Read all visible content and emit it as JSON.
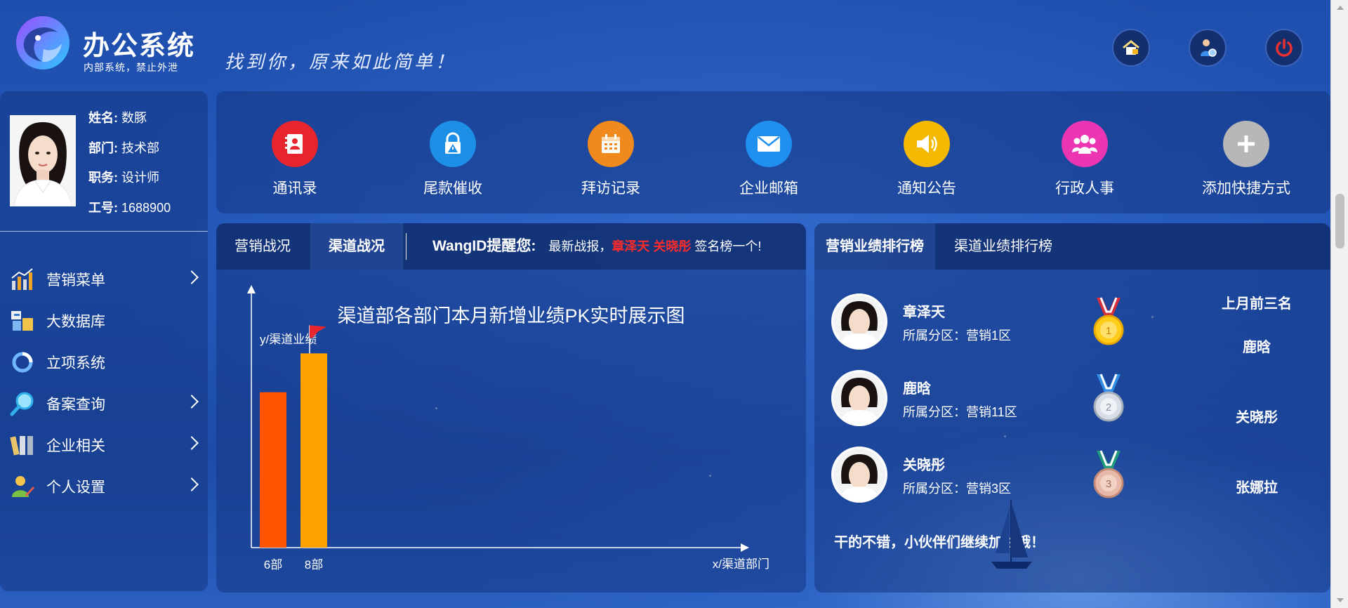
{
  "header": {
    "app_title": "办公系统",
    "app_subtitle": "内部系统，禁止外泄",
    "slogan": "找到你，原来如此简单！",
    "buttons": [
      {
        "icon": "home-icon"
      },
      {
        "icon": "user-settings-icon"
      },
      {
        "icon": "power-icon"
      }
    ]
  },
  "profile": {
    "name_label": "姓名:",
    "name": "数豚",
    "dept_label": "部门:",
    "dept": "技术部",
    "title_label": "职务:",
    "title": "设计师",
    "id_label": "工号:",
    "id": "1688900"
  },
  "menu": [
    {
      "label": "营销菜单",
      "icon": "chart-bars-icon",
      "has_arrow": true
    },
    {
      "label": "大数据库",
      "icon": "database-icon",
      "has_arrow": false
    },
    {
      "label": "立项系统",
      "icon": "refresh-icon",
      "has_arrow": false
    },
    {
      "label": "备案查询",
      "icon": "magnifier-icon",
      "has_arrow": true
    },
    {
      "label": "企业相关",
      "icon": "folders-icon",
      "has_arrow": true
    },
    {
      "label": "个人设置",
      "icon": "user-edit-icon",
      "has_arrow": true
    }
  ],
  "quick_actions": [
    {
      "label": "通讯录",
      "icon": "contacts-icon",
      "color": "#e8242c"
    },
    {
      "label": "尾款催收",
      "icon": "lock-alert-icon",
      "color": "#1e8fe6"
    },
    {
      "label": "拜访记录",
      "icon": "calendar-icon",
      "color": "#f18a1c"
    },
    {
      "label": "企业邮箱",
      "icon": "mail-icon",
      "color": "#1f8ff0"
    },
    {
      "label": "通知公告",
      "icon": "speaker-icon",
      "color": "#f5b800"
    },
    {
      "label": "行政人事",
      "icon": "people-icon",
      "color": "#ec35b3"
    },
    {
      "label": "添加快捷方式",
      "icon": "plus-icon",
      "color": "#b7b7b7"
    }
  ],
  "chart_panel": {
    "tabs": [
      "营销战况",
      "渠道战况"
    ],
    "active_tab": 1,
    "ticker_lead": "WangID提醒您:",
    "ticker_text_before": "最新战报，",
    "ticker_names": "章泽天 关晓彤",
    "ticker_text_after": "签名榜一个!",
    "ticker_overflow": "2"
  },
  "chart_data": {
    "type": "bar",
    "title": "渠道部各部门本月新增业绩PK实时展示图",
    "ylabel": "y/渠道业绩",
    "xlabel": "x/渠道部门",
    "categories": [
      "6部",
      "8部"
    ],
    "values": [
      80,
      100
    ],
    "ylim": [
      0,
      120
    ],
    "colors": [
      "#ff5500",
      "#ffa200"
    ],
    "flag_on": "8部",
    "grid": false
  },
  "rank_panel": {
    "tabs": [
      "营销业绩排行榜",
      "渠道业绩排行榜"
    ],
    "active_tab": 0,
    "entries": [
      {
        "name": "章泽天",
        "zone": "所属分区：营销1区",
        "medal": "gold-medal-icon"
      },
      {
        "name": "鹿晗",
        "zone": "所属分区：营销11区",
        "medal": "silver-medal-icon"
      },
      {
        "name": "关晓彤",
        "zone": "所属分区：营销3区",
        "medal": "bronze-medal-icon"
      }
    ],
    "top3_title": "上月前三名",
    "top3": [
      "鹿晗",
      "关晓彤",
      "张娜拉"
    ],
    "cheer": "干的不错，小伙伴们继续加油哦！"
  }
}
